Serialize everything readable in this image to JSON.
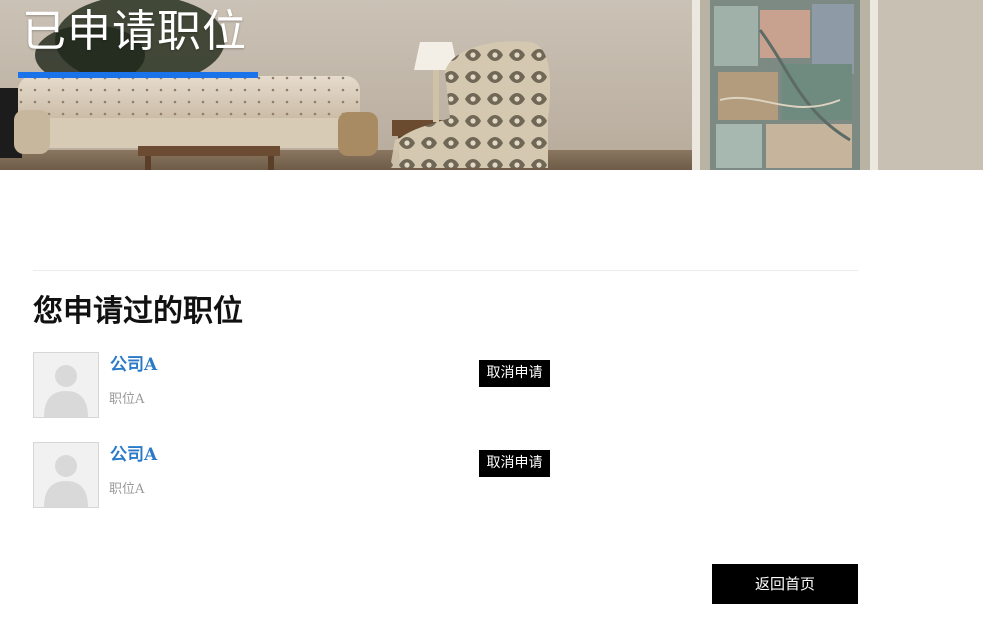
{
  "banner": {
    "title": "已申请职位",
    "underline_color": "#1a73e8"
  },
  "main": {
    "heading": "您申请过的职位",
    "applications": [
      {
        "company": "公司A",
        "position": "职位A",
        "cancel_label": "取消申请",
        "avatar_icon": "default-person-silhouette"
      },
      {
        "company": "公司A",
        "position": "职位A",
        "cancel_label": "取消申请",
        "avatar_icon": "default-person-silhouette"
      }
    ],
    "home_label": "返回首页"
  },
  "colors": {
    "link": "#2a7ac8",
    "button_bg": "#000000",
    "button_text": "#ffffff",
    "muted_text": "#9a9a9a"
  }
}
